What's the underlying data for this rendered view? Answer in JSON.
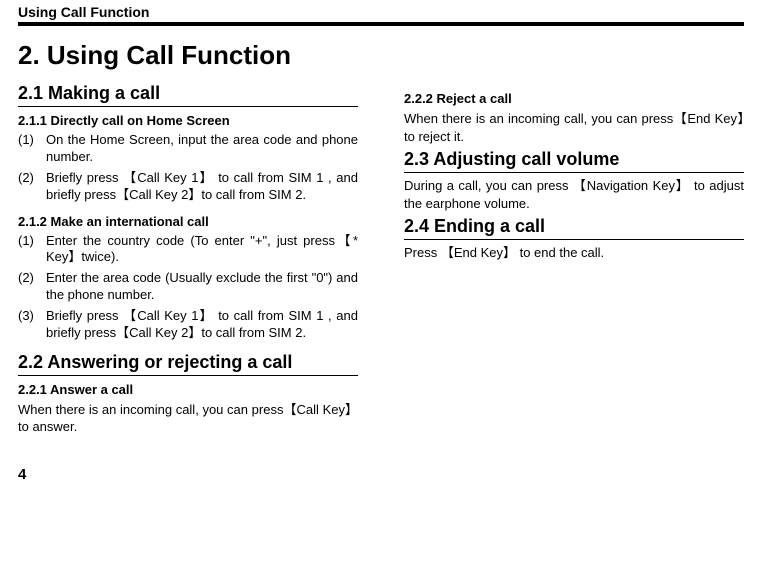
{
  "header": "Using Call Function",
  "title": "2.  Using Call Function",
  "s21": {
    "title": "2.1 Making a call",
    "s211": {
      "title": "2.1.1 Directly call on Home Screen",
      "items": [
        {
          "n": "(1)",
          "t": "On the Home Screen, input the area code and phone number."
        },
        {
          "n": "(2)",
          "t": "Briefly press 【Call Key 1】 to call from SIM 1 , and briefly press【Call Key 2】to call from SIM 2."
        }
      ]
    },
    "s212": {
      "title": "2.1.2 Make an international call",
      "items": [
        {
          "n": "(1)",
          "t": "Enter the country code (To enter \"+\", just press【* Key】twice)."
        },
        {
          "n": "(2)",
          "t": "Enter the area code (Usually exclude the first \"0\") and the phone number."
        },
        {
          "n": "(3)",
          "t": "Briefly press 【Call Key 1】 to call from SIM 1 , and briefly press【Call Key 2】to call from SIM 2."
        }
      ]
    }
  },
  "s22": {
    "title": "2.2 Answering or rejecting a call",
    "s221": {
      "title": "2.2.1 Answer a call",
      "text": "When there is an incoming call, you can press【Call Key】to answer."
    },
    "s222": {
      "title": "2.2.2 Reject a call",
      "text": "When there is an incoming call, you can press【End Key】to reject it."
    }
  },
  "s23": {
    "title": "2.3 Adjusting call volume",
    "text": "During a call, you can press  【Navigation Key】  to adjust the earphone volume."
  },
  "s24": {
    "title": "2.4 Ending a call",
    "text": "Press  【End Key】  to end the call."
  },
  "page_number": "4"
}
